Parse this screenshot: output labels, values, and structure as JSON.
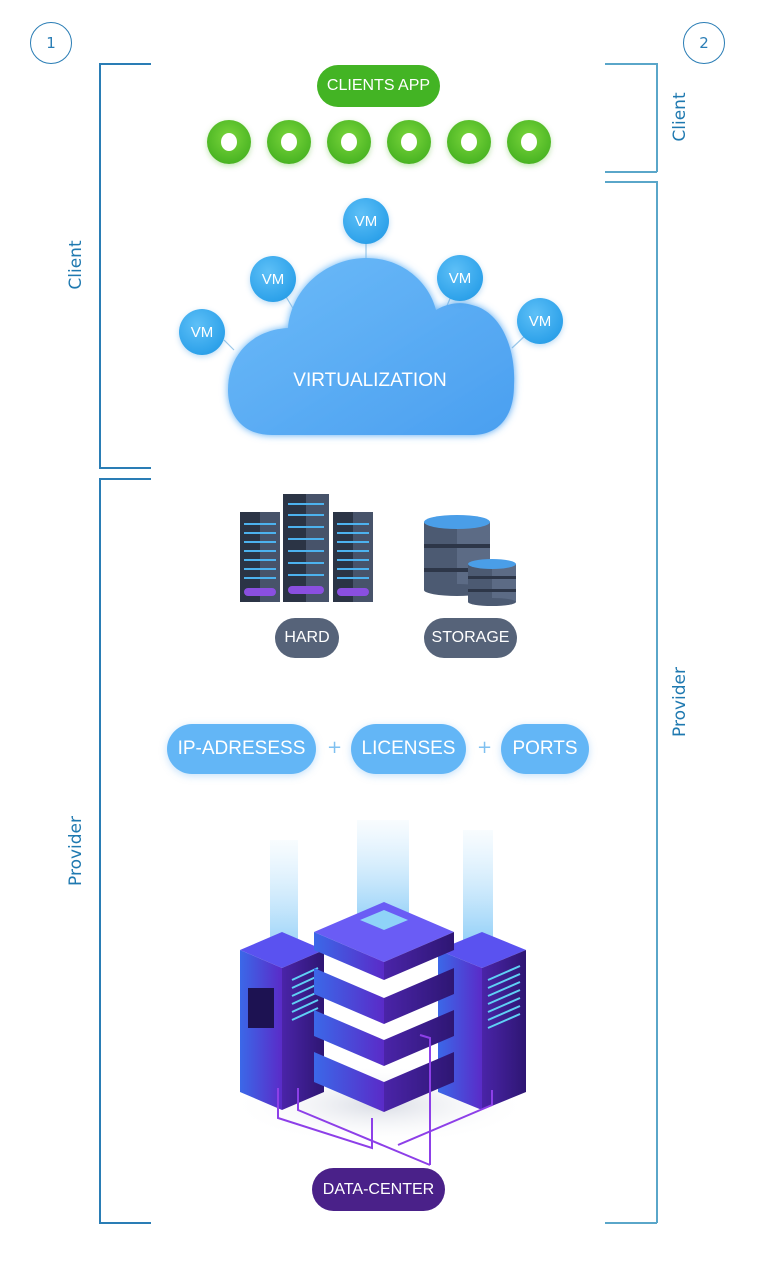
{
  "markers": {
    "left": "1",
    "right": "2"
  },
  "side_labels": {
    "left_client": "Client",
    "left_provider": "Provider",
    "right_client": "Client",
    "right_provider": "Provider"
  },
  "clients_app": {
    "label": "CLIENTS APP",
    "app_count": 6,
    "color": "#43b424"
  },
  "virtualization": {
    "label": "VIRTUALIZATION",
    "vms": [
      "VM",
      "VM",
      "VM",
      "VM",
      "VM"
    ],
    "color": "#5aaef3"
  },
  "hardware": {
    "hard_label": "HARD",
    "storage_label": "STORAGE",
    "color": "#566379"
  },
  "resources": {
    "items": [
      "IP-ADRESESS",
      "LICENSES",
      "PORTS"
    ],
    "separator": "+",
    "color": "#63b6f6"
  },
  "datacenter": {
    "label": "DATA-CENTER",
    "color": "#4a2189"
  },
  "accent": "#2a7db5"
}
